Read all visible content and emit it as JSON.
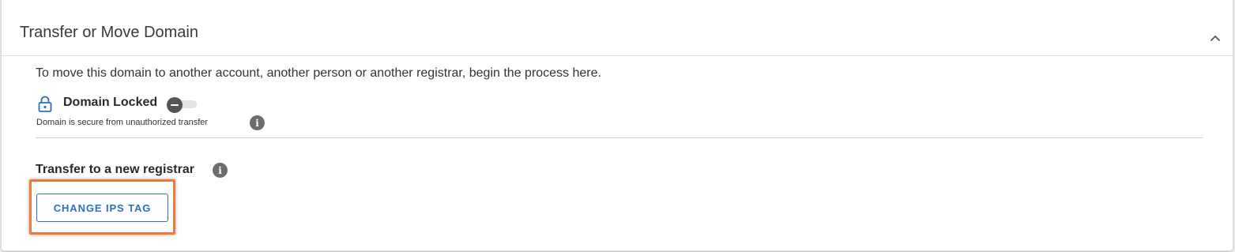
{
  "section": {
    "title": "Transfer or Move Domain",
    "collapse_icon": "chevron-up-icon",
    "description": "To move this domain to another account, another person or another registrar, begin the process here."
  },
  "domain_lock": {
    "icon": "lock-icon",
    "label": "Domain Locked",
    "toggle_state": "locked",
    "subtext": "Domain is secure from unauthorized transfer",
    "info_icon": "info-icon"
  },
  "transfer": {
    "label": "Transfer to a new registrar",
    "info_icon": "info-icon",
    "button_label": "CHANGE IPS TAG"
  },
  "colors": {
    "accent": "#2d6fc1",
    "highlight": "#f07a3c",
    "info_icon_bg": "#6d6d6d"
  }
}
